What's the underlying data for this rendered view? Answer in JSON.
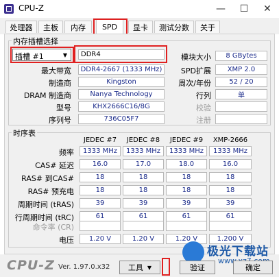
{
  "window": {
    "title": "CPU-Z",
    "minimize": "—",
    "maximize": "☐",
    "close": "✕"
  },
  "tabs": [
    "处理器",
    "主板",
    "内存",
    "SPD",
    "显卡",
    "测试分数",
    "关于"
  ],
  "slot_group": {
    "label": "内存插槽选择",
    "slot_select": "插槽 #1",
    "module_type": "DDR4",
    "fields_left": [
      {
        "label": "最大带宽",
        "value": "DDR4-2667 (1333 MHz)"
      },
      {
        "label": "制造商",
        "value": "Kingston"
      },
      {
        "label": "DRAM 制造商",
        "value": "Nanya Technology"
      },
      {
        "label": "型号",
        "value": "KHX2666C16/8G"
      },
      {
        "label": "序列号",
        "value": "736C05F7"
      }
    ],
    "fields_right": [
      {
        "label": "模块大小",
        "value": "8 GBytes"
      },
      {
        "label": "SPD扩展",
        "value": "XMP 2.0"
      },
      {
        "label": "周次/年份",
        "value": "52 / 20"
      },
      {
        "label": "行列",
        "value": "单"
      },
      {
        "label": "校验",
        "value": ""
      },
      {
        "label": "注册",
        "value": ""
      }
    ]
  },
  "timing_group": {
    "label": "时序表",
    "columns": [
      "JEDEC #7",
      "JEDEC #8",
      "JEDEC #9",
      "XMP-2666"
    ],
    "rows": [
      {
        "label": "频率",
        "values": [
          "1333 MHz",
          "1333 MHz",
          "1333 MHz",
          "1333 MHz"
        ]
      },
      {
        "label": "CAS# 延迟",
        "values": [
          "16.0",
          "17.0",
          "18.0",
          "16.0"
        ]
      },
      {
        "label": "RAS# 到CAS#",
        "values": [
          "18",
          "18",
          "18",
          "18"
        ]
      },
      {
        "label": "RAS# 预充电",
        "values": [
          "18",
          "18",
          "18",
          "18"
        ]
      },
      {
        "label": "周期时间 (tRAS)",
        "values": [
          "39",
          "39",
          "39",
          "39"
        ]
      },
      {
        "label": "行周期时间 (tRC)",
        "values": [
          "61",
          "61",
          "61",
          "61"
        ]
      },
      {
        "label": "命令率 (CR)",
        "values": [
          "",
          "",
          "",
          ""
        ]
      },
      {
        "label": "电压",
        "values": [
          "1.20 V",
          "1.20 V",
          "1.20 V",
          "1.200 V"
        ]
      }
    ]
  },
  "footer": {
    "logo": "CPU-Z",
    "version": "Ver. 1.97.0.x32",
    "tools_label": "工具",
    "validate_label": "验证",
    "ok_label": "确定"
  },
  "watermark": {
    "name": "极光下载站",
    "url": "www.xz7.com"
  },
  "colors": {
    "highlight": "#e02020",
    "value_text": "#1a2a8a"
  }
}
